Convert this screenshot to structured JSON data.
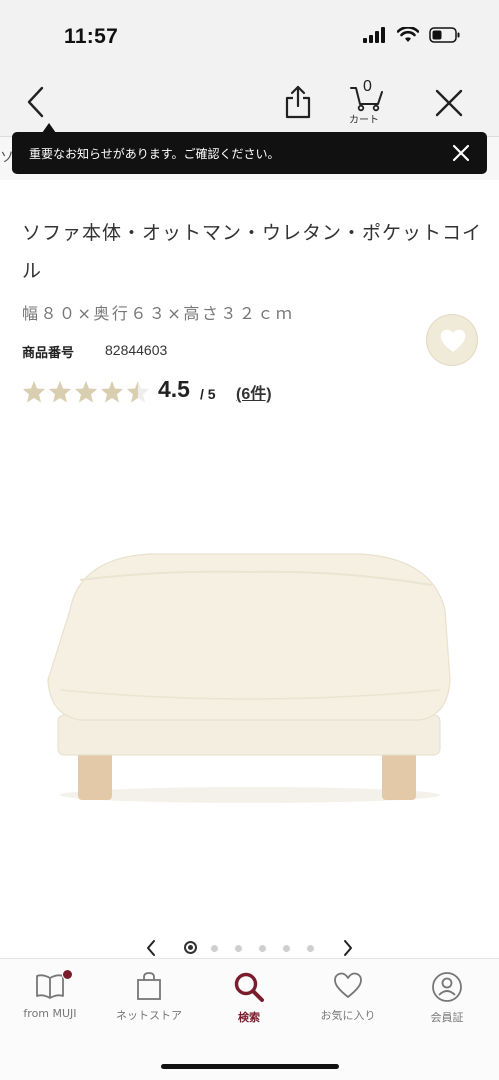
{
  "status": {
    "time": "11:57"
  },
  "nav": {
    "cart_count": "0",
    "cart_label": "カート"
  },
  "strip_char": "ソ",
  "notice": {
    "text": "重要なお知らせがあります。ご確認ください。"
  },
  "product": {
    "title": "ソファ本体・オットマン・ウレタン・ポケットコイル",
    "size": "幅８０×奥行６３×高さ３２ｃｍ",
    "item_no_label": "商品番号",
    "item_no": "82844603",
    "rating": 4.5,
    "rating_text": "4.5",
    "rating_max": "/ 5",
    "review_count": "(6件)"
  },
  "pager": {
    "total": 6,
    "current": 1
  },
  "tabs": [
    {
      "label": "from MUJI",
      "icon": "book-icon",
      "badge": true
    },
    {
      "label": "ネットストア",
      "icon": "bag-icon"
    },
    {
      "label": "検索",
      "icon": "search-icon",
      "active": true
    },
    {
      "label": "お気に入り",
      "icon": "heart-icon"
    },
    {
      "label": "会員証",
      "icon": "member-icon"
    }
  ],
  "colors": {
    "accent": "#7b1c2c",
    "star": "#d9ceb0",
    "fav_bg": "#f0ead9"
  }
}
